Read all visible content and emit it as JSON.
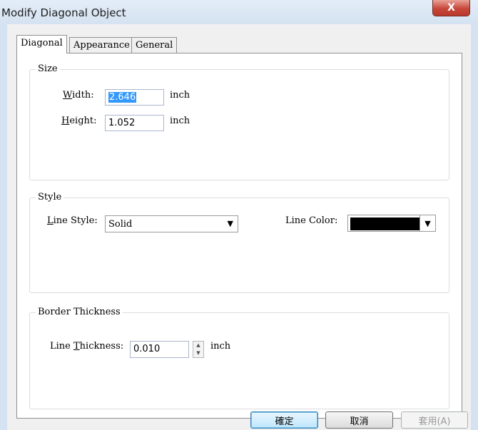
{
  "window": {
    "title": "Modify Diagonal Object",
    "close_glyph": "X"
  },
  "tabs": [
    {
      "label": "Diagonal",
      "active": true
    },
    {
      "label": "Appearance",
      "active": false
    },
    {
      "label": "General",
      "active": false
    }
  ],
  "size_group": {
    "label": "Size",
    "width": {
      "label_prefix": "",
      "label_mnemonic": "W",
      "label_rest": "idth:",
      "value": "2.646",
      "unit": "inch"
    },
    "height": {
      "label_prefix": "",
      "label_mnemonic": "H",
      "label_rest": "eight:",
      "value": "1.052",
      "unit": "inch"
    }
  },
  "style_group": {
    "label": "Style",
    "line_style": {
      "label_prefix": "",
      "label_mnemonic": "L",
      "label_rest": "ine Style:",
      "value": "Solid"
    },
    "line_color": {
      "label": "Line Color:",
      "value_color": "#000000"
    }
  },
  "border_group": {
    "label": "Border Thickness",
    "line_thickness": {
      "label_prefix": "Line ",
      "label_mnemonic": "T",
      "label_rest": "hickness:",
      "value": "0.010",
      "unit": "inch"
    }
  },
  "buttons": {
    "ok": "確定",
    "cancel": "取消",
    "apply": "套用(A)"
  }
}
